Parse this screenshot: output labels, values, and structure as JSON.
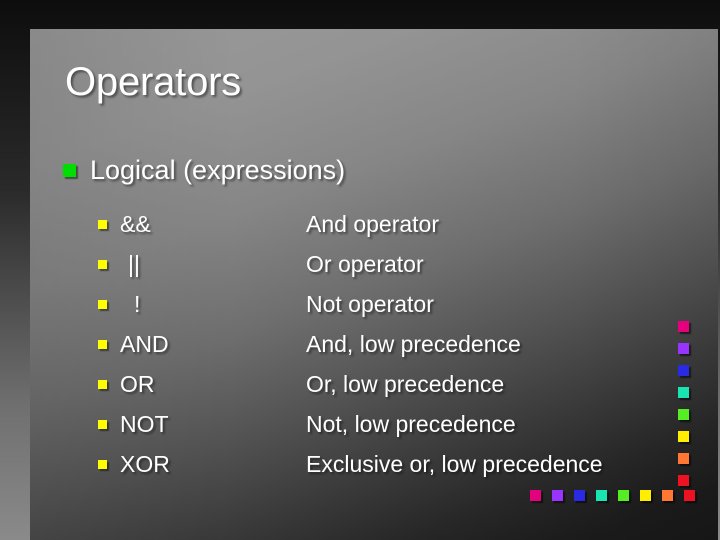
{
  "slide": {
    "title": "Operators",
    "level1_bullet": {
      "marker": "green-square-bullet",
      "text": "Logical (expressions)"
    },
    "rows": [
      {
        "marker": "yellow-square-bullet",
        "operator": "&&",
        "description": "And operator"
      },
      {
        "marker": "yellow-square-bullet",
        "operator": "||",
        "description": "Or operator"
      },
      {
        "marker": "yellow-square-bullet",
        "operator": "!",
        "description": "Not operator"
      },
      {
        "marker": "yellow-square-bullet",
        "operator": "AND",
        "description": "And, low precedence"
      },
      {
        "marker": "yellow-square-bullet",
        "operator": "OR",
        "description": "Or, low precedence"
      },
      {
        "marker": "yellow-square-bullet",
        "operator": "NOT",
        "description": "Not, low precedence"
      },
      {
        "marker": "yellow-square-bullet",
        "operator": "XOR",
        "description": "Exclusive or, low precedence"
      }
    ]
  },
  "colors": {
    "bullet_level1": "#00DD00",
    "bullet_level2": "#FFFF00",
    "text": "#FFFFFF",
    "panel_light": "#999999",
    "panel_dark": "#171717"
  },
  "decoration": {
    "column_swatches": [
      "#E5007D",
      "#9933FF",
      "#2A2AE5",
      "#19E5B2",
      "#55EE22",
      "#FFEE00",
      "#FF7733",
      "#EE1122"
    ],
    "row_swatches": [
      "#E5007D",
      "#9933FF",
      "#2A2AE5",
      "#19E5B2",
      "#55EE22",
      "#FFEE00",
      "#FF7733",
      "#EE1122"
    ]
  }
}
